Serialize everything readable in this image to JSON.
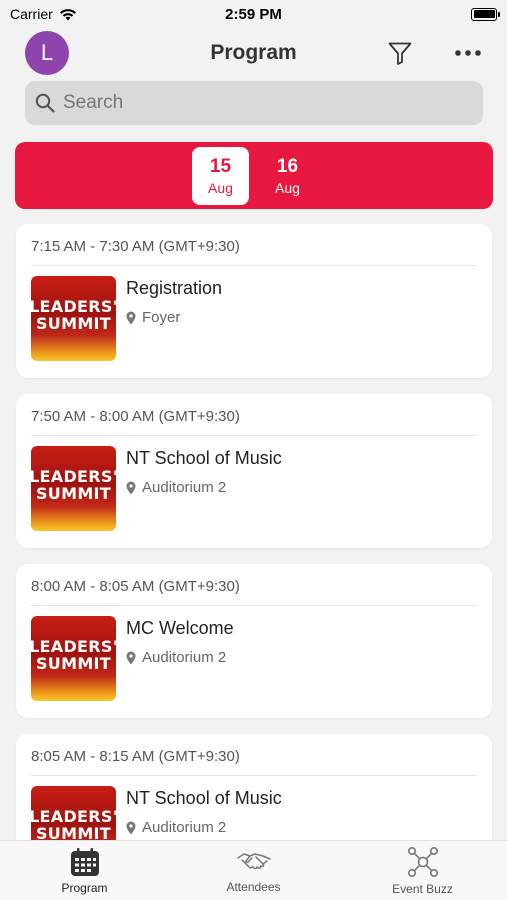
{
  "status_bar": {
    "carrier": "Carrier",
    "time": "2:59 PM"
  },
  "header": {
    "avatar_initial": "L",
    "title": "Program"
  },
  "search": {
    "placeholder": "Search"
  },
  "dates": [
    {
      "day": "15",
      "month": "Aug",
      "selected": true
    },
    {
      "day": "16",
      "month": "Aug",
      "selected": false
    }
  ],
  "sessions": [
    {
      "time": "7:15 AM - 7:30 AM (GMT+9:30)",
      "title": "Registration",
      "location": "Foyer",
      "thumb_text": "LEADERS' SUMMIT"
    },
    {
      "time": "7:50 AM - 8:00 AM (GMT+9:30)",
      "title": "NT School of Music",
      "location": "Auditorium 2",
      "thumb_text": "LEADERS' SUMMIT"
    },
    {
      "time": "8:00 AM - 8:05 AM (GMT+9:30)",
      "title": "MC Welcome",
      "location": "Auditorium 2",
      "thumb_text": "LEADERS' SUMMIT"
    },
    {
      "time": "8:05 AM - 8:15 AM (GMT+9:30)",
      "title": "NT School of Music",
      "location": "Auditorium 2",
      "thumb_text": "LEADERS' SUMMIT"
    }
  ],
  "tabs": [
    {
      "label": "Program",
      "icon": "calendar-icon",
      "active": true
    },
    {
      "label": "Attendees",
      "icon": "handshake-icon",
      "active": false
    },
    {
      "label": "Event Buzz",
      "icon": "network-icon",
      "active": false
    }
  ],
  "colors": {
    "accent": "#e8173f",
    "avatar": "#8e44ad"
  }
}
